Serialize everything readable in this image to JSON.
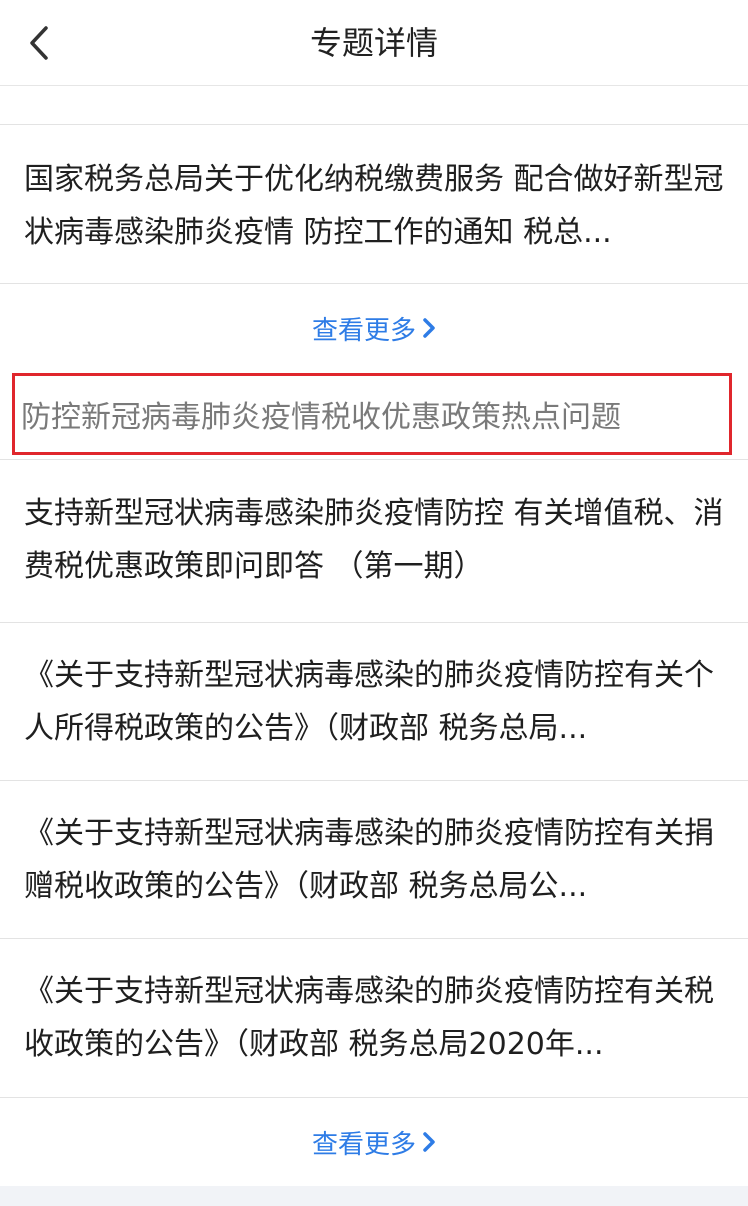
{
  "navbar": {
    "title": "专题详情"
  },
  "section1": {
    "items": [
      {
        "text": "国家税务总局关于优化纳税缴费服务 配合做好新型冠状病毒感染肺炎疫情 防控工作的通知 税总..."
      }
    ],
    "more_label": "查看更多"
  },
  "section2": {
    "header": "防控新冠病毒肺炎疫情税收优惠政策热点问题",
    "items": [
      {
        "text": "支持新型冠状病毒感染肺炎疫情防控 有关增值税、消费税优惠政策即问即答 （第一期）"
      },
      {
        "text": "《关于支持新型冠状病毒感染的肺炎疫情防控有关个人所得税政策的公告》（财政部 税务总局..."
      },
      {
        "text": "《关于支持新型冠状病毒感染的肺炎疫情防控有关捐赠税收政策的公告》（财政部 税务总局公..."
      },
      {
        "text": "《关于支持新型冠状病毒感染的肺炎疫情防控有关税收政策的公告》（财政部 税务总局2020年..."
      }
    ],
    "more_label": "查看更多"
  },
  "colors": {
    "link": "#2e7ce6",
    "highlight_border": "#e0262c",
    "header_text": "#7a7a7a"
  }
}
